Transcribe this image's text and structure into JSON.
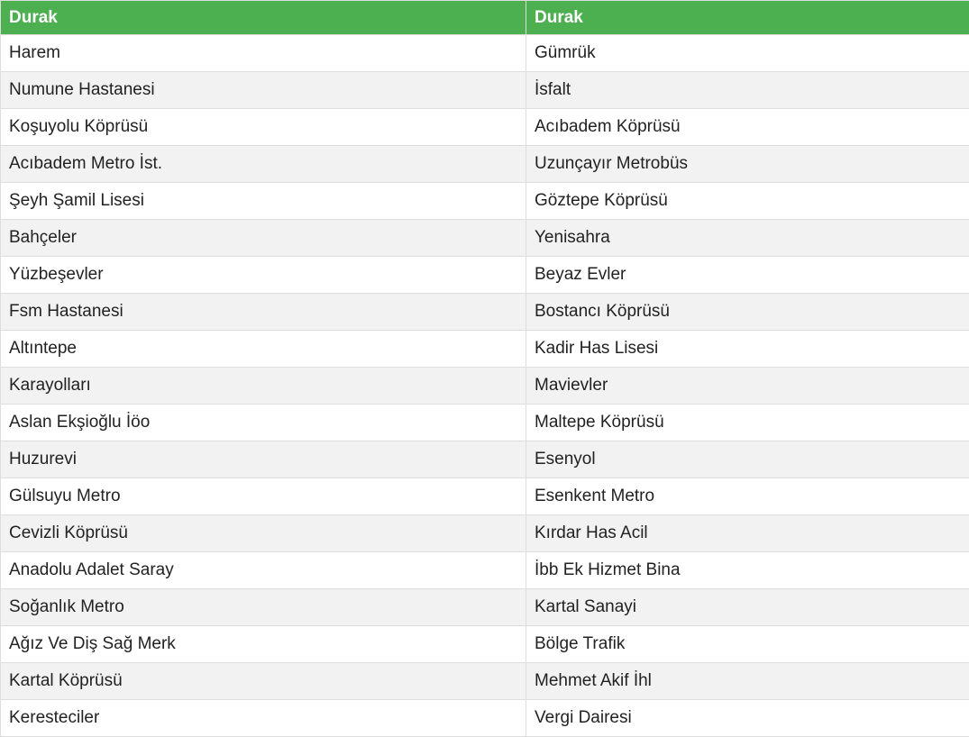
{
  "table": {
    "headers": [
      "Durak",
      "Durak"
    ],
    "rows": [
      [
        "Harem",
        "Gümrük"
      ],
      [
        "Numune Hastanesi",
        "İsfalt"
      ],
      [
        "Koşuyolu Köprüsü",
        "Acıbadem Köprüsü"
      ],
      [
        "Acıbadem Metro İst.",
        "Uzunçayır Metrobüs"
      ],
      [
        "Şeyh Şamil Lisesi",
        "Göztepe Köprüsü"
      ],
      [
        "Bahçeler",
        "Yenisahra"
      ],
      [
        "Yüzbeşevler",
        "Beyaz Evler"
      ],
      [
        "Fsm Hastanesi",
        "Bostancı Köprüsü"
      ],
      [
        "Altıntepe",
        "Kadir Has Lisesi"
      ],
      [
        "Karayolları",
        "Mavievler"
      ],
      [
        "Aslan Ekşioğlu İöo",
        "Maltepe Köprüsü"
      ],
      [
        "Huzurevi",
        "Esenyol"
      ],
      [
        "Gülsuyu Metro",
        "Esenkent Metro"
      ],
      [
        "Cevizli Köprüsü",
        "Kırdar Has Acil"
      ],
      [
        "Anadolu Adalet Saray",
        "İbb Ek Hizmet Bina"
      ],
      [
        "Soğanlık Metro",
        "Kartal Sanayi"
      ],
      [
        "Ağız Ve Diş Sağ Merk",
        "Bölge Trafik"
      ],
      [
        "Kartal Köprüsü",
        "Mehmet Akif İhl"
      ],
      [
        "Keresteciler",
        "Vergi Dairesi"
      ]
    ]
  },
  "colors": {
    "header_bg": "#4caf50",
    "header_text": "#ffffff",
    "row_alt_bg": "#f2f2f2",
    "border": "#dddddd"
  }
}
